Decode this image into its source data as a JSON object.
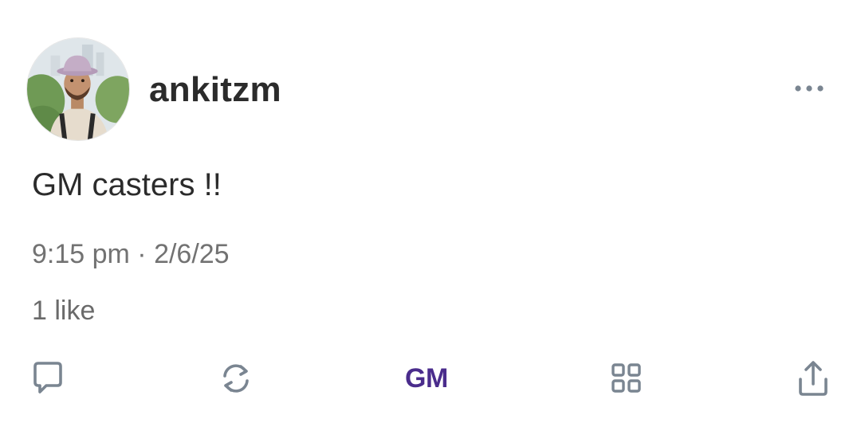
{
  "post": {
    "author": "ankitzm",
    "text": "GM casters !!",
    "timestamp": "9:15 pm · 2/6/25",
    "likes": "1 like"
  },
  "actions": {
    "reply_icon": "reply-icon",
    "recast_icon": "recast-icon",
    "gm_label": "GM",
    "apps_icon": "grid-icon",
    "share_icon": "share-icon"
  },
  "colors": {
    "text": "#2b2b2b",
    "muted": "#727272",
    "icon": "#7a8591",
    "accent": "#4a2c8c"
  }
}
